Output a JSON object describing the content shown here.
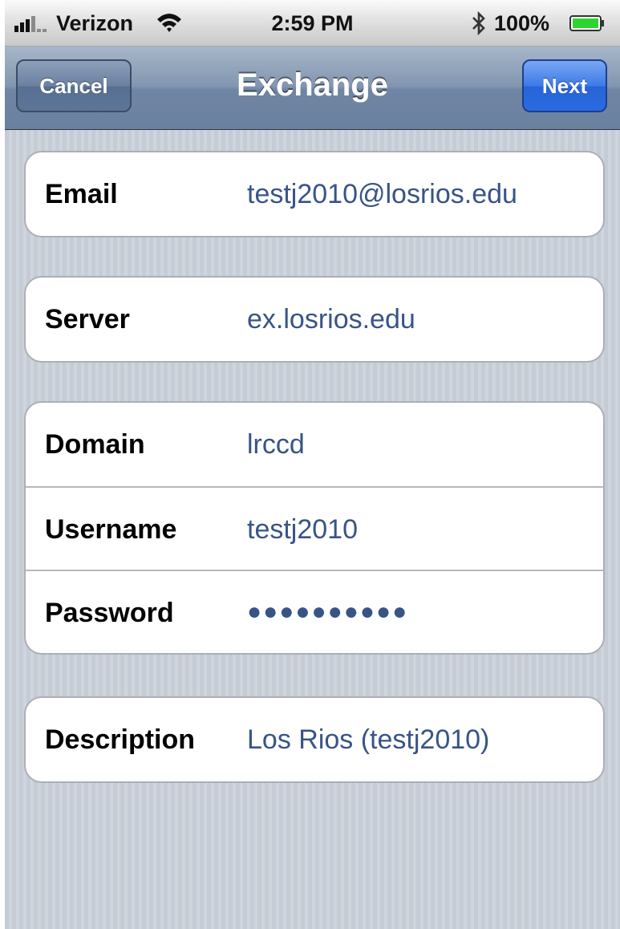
{
  "status_bar": {
    "carrier": "Verizon",
    "time": "2:59 PM",
    "battery_percent": "100%",
    "signal_icon": "signal-bars-icon",
    "wifi_icon": "wifi-icon",
    "bluetooth_icon": "bluetooth-icon",
    "battery_icon": "battery-icon",
    "battery_color": "#2ed52e"
  },
  "nav": {
    "title": "Exchange",
    "cancel_label": "Cancel",
    "next_label": "Next"
  },
  "account_group": {
    "email_label": "Email",
    "email_value": "testj2010@losrios.edu"
  },
  "server_group": {
    "server_label": "Server",
    "server_value": "ex.losrios.edu"
  },
  "credentials_group": {
    "domain_label": "Domain",
    "domain_value": "lrccd",
    "username_label": "Username",
    "username_value": "testj2010",
    "password_label": "Password",
    "password_value": "●●●●●●●●●●"
  },
  "description_group": {
    "description_label": "Description",
    "description_value": "Los Rios (testj2010)"
  },
  "colors": {
    "value_text": "#385487",
    "nav_bar": "#6b81a0",
    "next_button": "#2b6ae0"
  }
}
